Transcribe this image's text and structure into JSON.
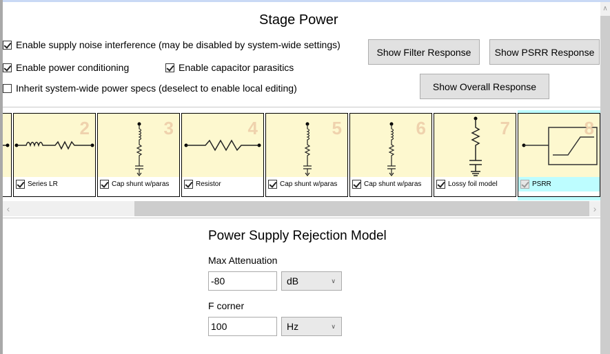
{
  "title": "Stage Power",
  "options": [
    {
      "label": "Enable supply noise interference (may be disabled by system-wide settings)",
      "checked": true
    },
    {
      "label": "Enable power conditioning",
      "checked": true
    },
    {
      "label": "Enable capacitor parasitics",
      "checked": true
    },
    {
      "label": "Inherit system-wide power specs (deselect to enable local editing)",
      "checked": false
    }
  ],
  "buttons": {
    "filter": "Show Filter Response",
    "psrr": "Show PSRR Response",
    "overall": "Show Overall Response"
  },
  "stages": [
    {
      "num": "2",
      "label": "Series LR",
      "icon": "series-lr-icon",
      "checked": true
    },
    {
      "num": "3",
      "label": "Cap shunt w/paras",
      "icon": "cap-shunt-icon",
      "checked": true
    },
    {
      "num": "4",
      "label": "Resistor",
      "icon": "resistor-icon",
      "checked": true
    },
    {
      "num": "5",
      "label": "Cap shunt w/paras",
      "icon": "cap-shunt-icon",
      "checked": true
    },
    {
      "num": "6",
      "label": "Cap shunt w/paras",
      "icon": "cap-shunt-icon",
      "checked": true
    },
    {
      "num": "7",
      "label": "Lossy foil model",
      "icon": "lossy-foil-icon",
      "checked": true
    },
    {
      "num": "8",
      "label": "PSRR",
      "icon": "psrr-icon",
      "checked": true,
      "selected": true
    }
  ],
  "psrr": {
    "heading": "Power Supply Rejection Model",
    "max_attenuation": {
      "label": "Max Attenuation",
      "value": "-80",
      "unit": "dB"
    },
    "f_corner": {
      "label": "F corner",
      "value": "100",
      "unit": "Hz"
    }
  },
  "colors": {
    "card_bg": "#fdf8cf",
    "selected": "#bdfdff",
    "number": "#efd2ad"
  }
}
